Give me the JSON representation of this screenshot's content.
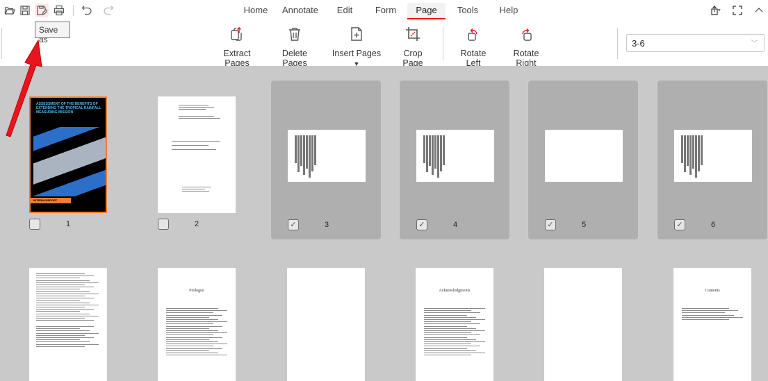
{
  "quick_access": [
    {
      "name": "open-icon",
      "label": ""
    },
    {
      "name": "save-icon",
      "label": ""
    },
    {
      "name": "save-as-icon",
      "label": ""
    },
    {
      "name": "print-icon",
      "label": ""
    },
    {
      "name": "undo-icon",
      "label": ""
    },
    {
      "name": "redo-icon",
      "label": ""
    }
  ],
  "tooltip": "Save as",
  "tabs": [
    "Home",
    "Annotate",
    "Edit",
    "Form",
    "Page",
    "Tools",
    "Help"
  ],
  "active_tab": "Page",
  "ribbon": {
    "extract": "Extract Pages",
    "delete": "Delete Pages",
    "insert": "Insert Pages",
    "crop": "Crop Page",
    "rotate_left": "Rotate Left",
    "rotate_right": "Rotate Right"
  },
  "page_range": "3-6",
  "accent_color": "#e8141e",
  "pages": [
    {
      "number": "1",
      "selected": false,
      "kind": "cover",
      "title": "ASSESSMENT OF THE BENEFITS OF EXTENDING THE TROPICAL RAINFALL MEASURING MISSION",
      "badge": "INTERIM REPORT"
    },
    {
      "number": "2",
      "selected": false,
      "kind": "title"
    },
    {
      "number": "3",
      "selected": true,
      "kind": "landscape"
    },
    {
      "number": "4",
      "selected": true,
      "kind": "landscape"
    },
    {
      "number": "5",
      "selected": true,
      "kind": "landscape-blank"
    },
    {
      "number": "6",
      "selected": true,
      "kind": "landscape"
    },
    {
      "kind": "text"
    },
    {
      "kind": "heading",
      "heading": "Prologue"
    },
    {
      "kind": "blank"
    },
    {
      "kind": "heading",
      "heading": "Acknowledgments"
    },
    {
      "kind": "blank"
    },
    {
      "kind": "heading",
      "heading": "Contents"
    }
  ]
}
